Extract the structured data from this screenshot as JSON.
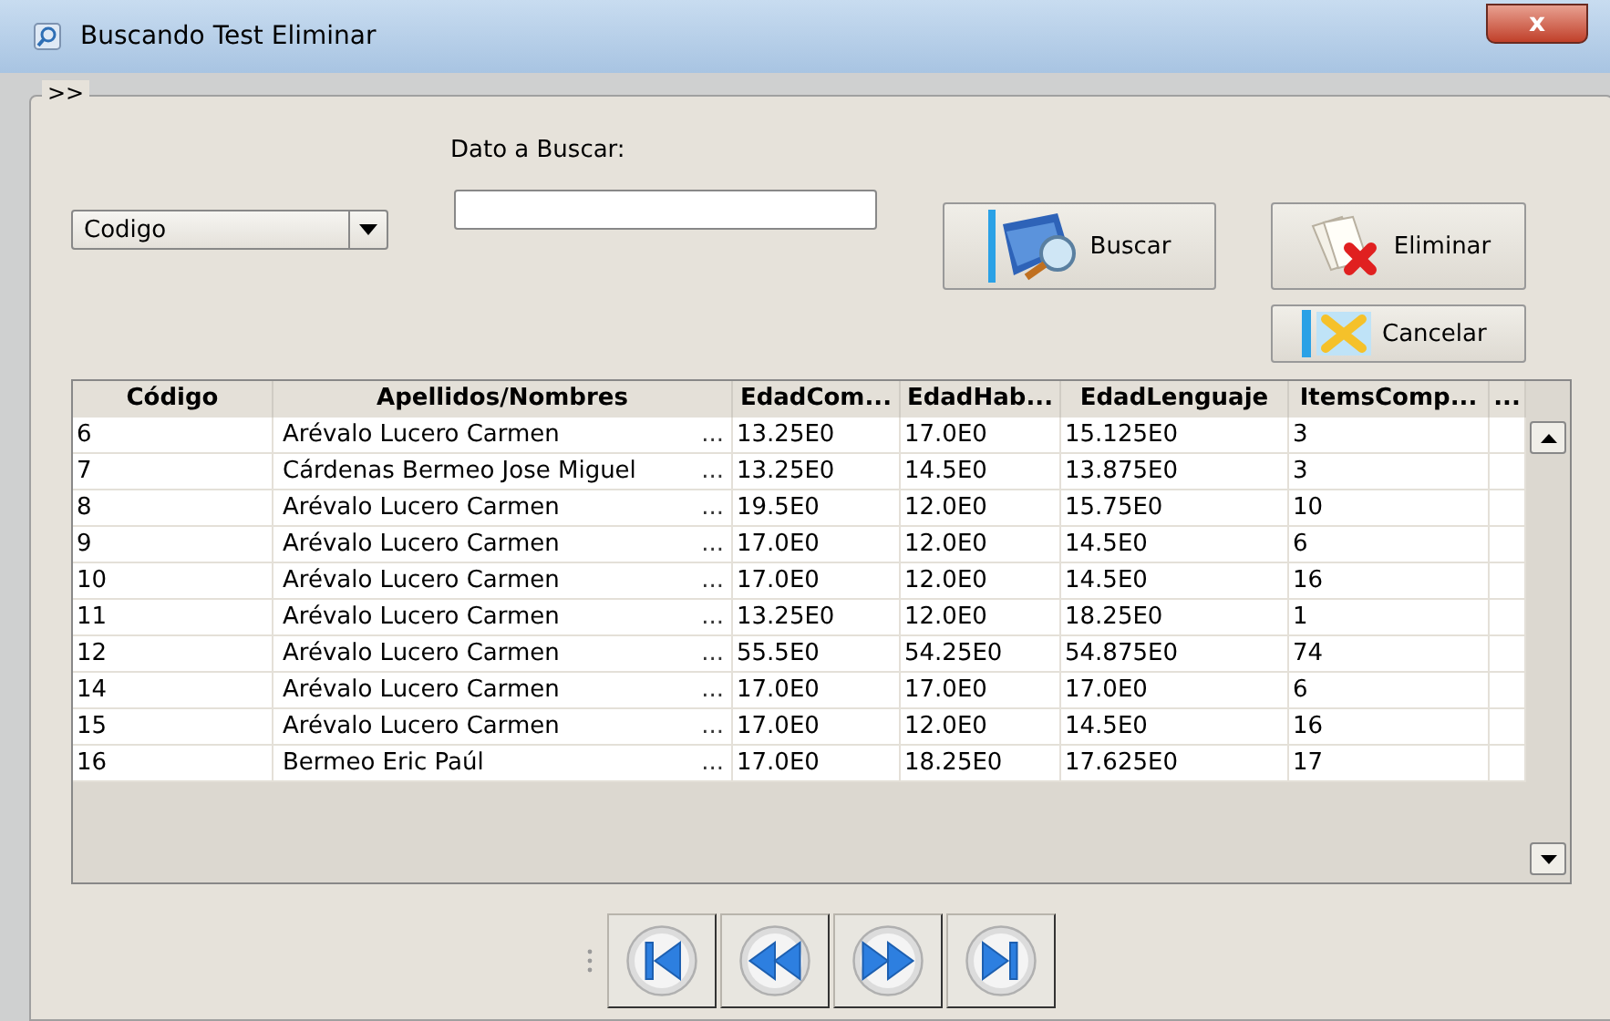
{
  "window": {
    "title": "Buscando Test Eliminar",
    "close": "x"
  },
  "group": {
    "legend": ">>"
  },
  "search": {
    "combo_value": "Codigo",
    "label": "Dato a Buscar:"
  },
  "buttons": [
    {
      "kind": "search",
      "label": "Buscar"
    },
    {
      "kind": "delete",
      "label": "Eliminar"
    },
    {
      "kind": "cancel",
      "label": "Cancelar"
    }
  ],
  "table": {
    "columns": [
      "Código",
      "Apellidos/Nombres",
      "EdadCom...",
      "EdadHab...",
      "EdadLenguaje",
      "ItemsComp...",
      "..."
    ],
    "rows": [
      {
        "cells": [
          "6",
          "Arévalo Lucero Carmen",
          "13.25E0",
          "17.0E0",
          "15.125E0",
          "3"
        ],
        "more": "..."
      },
      {
        "cells": [
          "7",
          "Cárdenas Bermeo Jose Miguel",
          "13.25E0",
          "14.5E0",
          "13.875E0",
          "3"
        ],
        "more": "..."
      },
      {
        "cells": [
          "8",
          "Arévalo Lucero Carmen",
          "19.5E0",
          "12.0E0",
          "15.75E0",
          "10"
        ],
        "more": "..."
      },
      {
        "cells": [
          "9",
          "Arévalo Lucero Carmen",
          "17.0E0",
          "12.0E0",
          "14.5E0",
          "6"
        ],
        "more": "..."
      },
      {
        "cells": [
          "10",
          "Arévalo Lucero Carmen",
          "17.0E0",
          "12.0E0",
          "14.5E0",
          "16"
        ],
        "more": "..."
      },
      {
        "cells": [
          "11",
          "Arévalo Lucero Carmen",
          "13.25E0",
          "12.0E0",
          "18.25E0",
          "1"
        ],
        "more": "..."
      },
      {
        "cells": [
          "12",
          "Arévalo Lucero Carmen",
          "55.5E0",
          "54.25E0",
          "54.875E0",
          "74"
        ],
        "more": "..."
      },
      {
        "cells": [
          "14",
          "Arévalo Lucero Carmen",
          "17.0E0",
          "17.0E0",
          "17.0E0",
          "6"
        ],
        "more": "..."
      },
      {
        "cells": [
          "15",
          "Arévalo Lucero Carmen",
          "17.0E0",
          "12.0E0",
          "14.5E0",
          "16"
        ],
        "more": "..."
      },
      {
        "cells": [
          "16",
          "Bermeo Eric Paúl",
          "17.0E0",
          "18.25E0",
          "17.625E0",
          "17"
        ],
        "more": "..."
      }
    ]
  },
  "navigator": [
    {
      "kind": "first"
    },
    {
      "kind": "prev"
    },
    {
      "kind": "next"
    },
    {
      "kind": "last"
    }
  ]
}
